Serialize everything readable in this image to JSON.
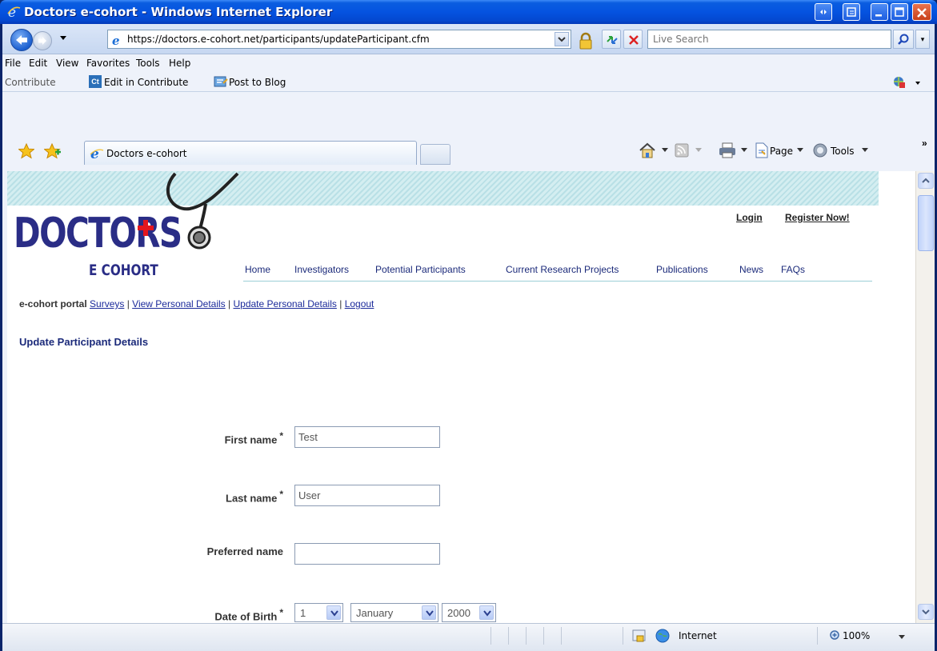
{
  "window": {
    "title": "Doctors e-cohort - Windows Internet Explorer"
  },
  "address": {
    "url": "https://doctors.e-cohort.net/participants/updateParticipant.cfm",
    "search_placeholder": "Live Search"
  },
  "menu": [
    "File",
    "Edit",
    "View",
    "Favorites",
    "Tools",
    "Help"
  ],
  "contribute": {
    "label": "Contribute",
    "edit_label": "Edit in Contribute",
    "blog_label": "Post to Blog",
    "ct_icon": "Ct"
  },
  "tab": {
    "title": "Doctors e-cohort"
  },
  "commands": {
    "page": "Page",
    "tools": "Tools"
  },
  "site": {
    "logo": {
      "main": "DOCTORS",
      "sub": "E COHORT"
    },
    "top_links": {
      "login": "Login",
      "register": "Register Now!"
    },
    "nav": [
      "Home",
      "Investigators",
      "Potential Participants",
      "Current Research Projects",
      "Publications",
      "News",
      "FAQs"
    ],
    "portal": {
      "label": "e-cohort portal",
      "links": [
        "Surveys",
        "View Personal Details",
        "Update Personal Details",
        "Logout"
      ],
      "sep": " | "
    },
    "heading": "Update Participant Details"
  },
  "form": {
    "required_mark": "*",
    "first_name": {
      "label": "First name",
      "value": "Test"
    },
    "last_name": {
      "label": "Last name",
      "value": "User"
    },
    "preferred_name": {
      "label": "Preferred name",
      "value": ""
    },
    "dob": {
      "label": "Date of Birth",
      "day": "1",
      "month": "January",
      "year": "2000"
    }
  },
  "status": {
    "zone": "Internet",
    "zoom": "100%"
  },
  "colors": {
    "brand": "#2a2d86",
    "cross": "#e4161e",
    "nav": "#1b2a7a",
    "titlebar": "#0553e0"
  }
}
